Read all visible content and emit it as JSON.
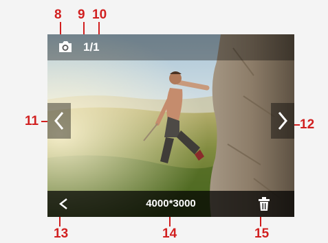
{
  "screen": {
    "top_bar": {
      "mode_icon": "camera-icon",
      "file_counter": "1/1"
    },
    "nav": {
      "left_icon": "chevron-left-icon",
      "right_icon": "chevron-right-icon"
    },
    "bottom_bar": {
      "back_icon": "back-icon",
      "resolution": "4000*3000",
      "delete_icon": "trash-icon"
    }
  },
  "callouts": [
    "8",
    "9",
    "10",
    "11",
    "12",
    "13",
    "14",
    "15"
  ],
  "colors": {
    "callout": "#d11f1f",
    "bar_overlay": "#000000"
  }
}
